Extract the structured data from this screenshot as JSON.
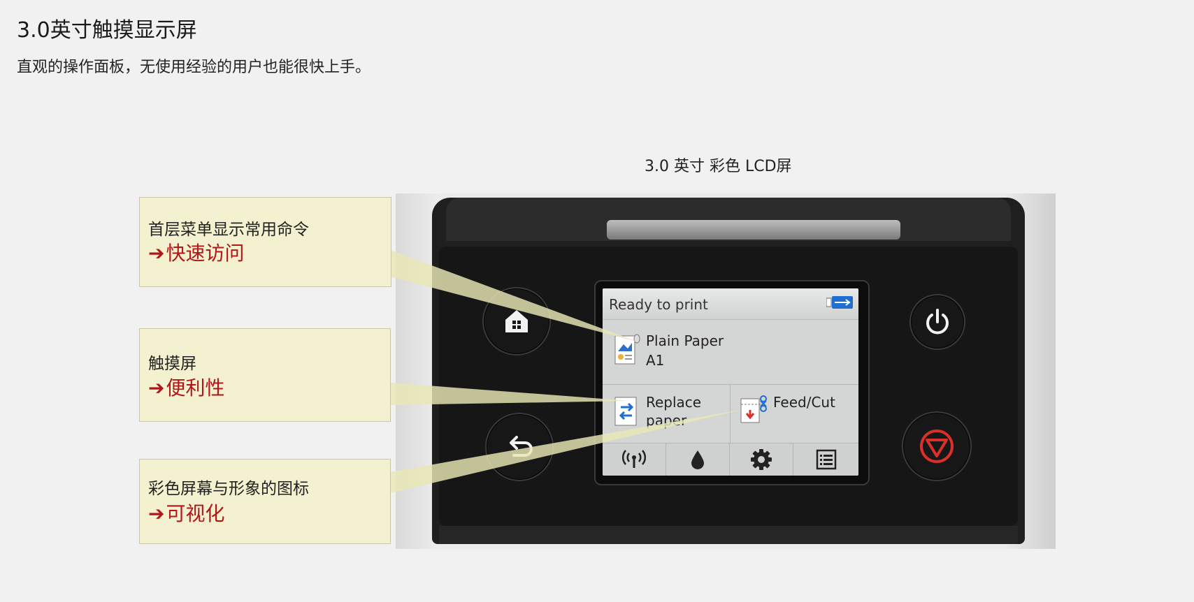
{
  "page": {
    "title": "3.0英寸触摸显示屏",
    "subtitle": "直观的操作面板，无使用经验的用户也能很快上手。",
    "figure_caption": "3.0 英寸 彩色 LCD屏"
  },
  "callouts": [
    {
      "label": "首层菜单显示常用命令",
      "arrow": "➔",
      "benefit": "快速访问"
    },
    {
      "label": "触摸屏",
      "arrow": "➔",
      "benefit": "便利性"
    },
    {
      "label": "彩色屏幕与形象的图标",
      "arrow": "➔",
      "benefit": "可视化"
    }
  ],
  "lcd": {
    "status_text": "Ready to print",
    "status_icon": "usb-icon",
    "paper": {
      "line1": "Plain Paper",
      "line2": "A1",
      "icon": "paper-roll-icon"
    },
    "replace": {
      "line1": "Replace",
      "line2": "paper",
      "icon": "replace-paper-icon"
    },
    "feed": {
      "label": "Feed/Cut",
      "icon": "feed-cut-icon"
    },
    "tabs": [
      "wireless-icon",
      "ink-drop-icon",
      "settings-gear-icon",
      "menu-list-icon"
    ]
  },
  "hardware_buttons": [
    "home-icon",
    "back-icon",
    "power-icon",
    "stop-icon"
  ],
  "colors": {
    "background": "#f1f1f1",
    "callout_fill": "#f3f1cf",
    "benefit_red": "#b2161a",
    "stop_red": "#d9302a"
  }
}
